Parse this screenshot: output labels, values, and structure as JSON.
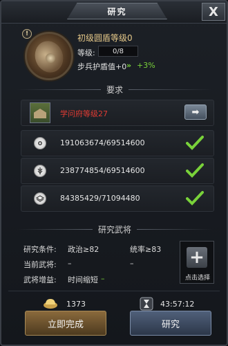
{
  "window": {
    "title": "研究",
    "close_label": "X"
  },
  "skill": {
    "name": "初级圆盾等级0",
    "level_label": "等级:",
    "level_value": "0/8",
    "effect_label": "步兵护盾值+0",
    "effect_arrow": "»",
    "effect_bonus": "+3%",
    "info_badge": "!"
  },
  "requirements": {
    "header": "要求",
    "items": [
      {
        "icon": "academy-building-icon",
        "text": "学问府等级27",
        "status": "unmet",
        "action": "go-arrow"
      },
      {
        "icon": "coin-icon",
        "text": "191063674/69514600",
        "status": "met"
      },
      {
        "icon": "grain-icon",
        "text": "238774854/69514600",
        "status": "met"
      },
      {
        "icon": "stone-icon",
        "text": "84385429/71094480",
        "status": "met"
      }
    ],
    "arrow_label": "➡"
  },
  "general": {
    "header": "研究武将",
    "condition_label": "研究条件:",
    "condition_politics": "政治≥82",
    "condition_command": "统率≥83",
    "current_label": "当前武将:",
    "current_value": "–",
    "current_value2": "–",
    "bonus_label": "武将增益:",
    "bonus_value": "时间缩短",
    "bonus_dash": "–",
    "slot_caption": "点击选择",
    "slot_plus": "+"
  },
  "cost": {
    "gold": "1373",
    "time": "43:57:12"
  },
  "buttons": {
    "finish": "立即完成",
    "research": "研究"
  },
  "colors": {
    "met": "#79d23a",
    "unmet": "#e03b33",
    "title_gold": "#e6c98a"
  }
}
